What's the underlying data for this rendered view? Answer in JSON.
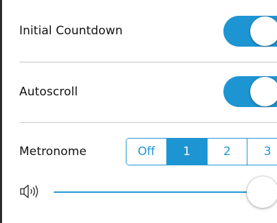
{
  "settings": {
    "initial_countdown": {
      "label": "Initial Countdown",
      "enabled": true
    },
    "autoscroll": {
      "label": "Autoscroll",
      "enabled": true
    },
    "metronome": {
      "label": "Metronome",
      "options": [
        "Off",
        "1",
        "2",
        "3"
      ],
      "selected": "1"
    },
    "volume": {
      "icon": "speaker-icon",
      "level": 1.0
    }
  },
  "colors": {
    "accent": "#1e95d3",
    "divider": "#c9c9c9",
    "text": "#111111"
  }
}
